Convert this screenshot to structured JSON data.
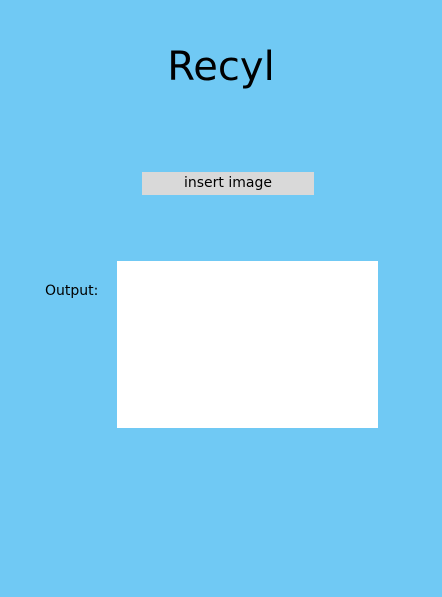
{
  "app": {
    "title": "Recyl"
  },
  "upload": {
    "button_label": "insert image"
  },
  "output": {
    "label": "Output:",
    "content": ""
  },
  "colors": {
    "background": "#70C9F4",
    "button": "#D9D9D9",
    "output_box": "#FFFFFF",
    "text": "#000000"
  }
}
